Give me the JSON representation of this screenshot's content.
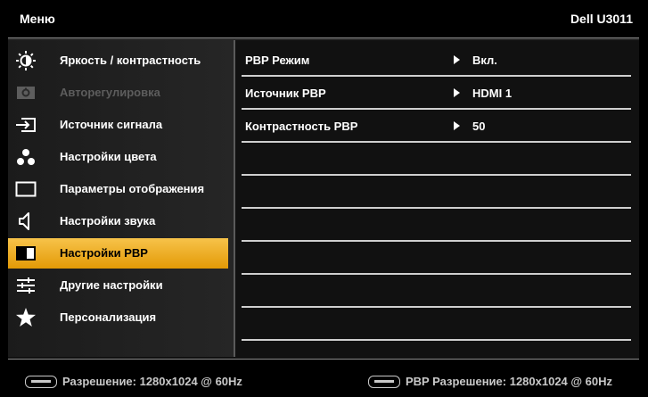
{
  "header": {
    "menu_title": "Меню",
    "model": "Dell U3011"
  },
  "sidebar": {
    "items": [
      {
        "label": "Яркость / контрастность",
        "icon": "brightness-icon",
        "state": "normal"
      },
      {
        "label": "Авторегулировка",
        "icon": "auto-adjust-icon",
        "state": "disabled"
      },
      {
        "label": "Источник сигнала",
        "icon": "input-source-icon",
        "state": "normal"
      },
      {
        "label": "Настройки цвета",
        "icon": "color-dots-icon",
        "state": "normal"
      },
      {
        "label": "Параметры отображения",
        "icon": "display-rectangle-icon",
        "state": "normal"
      },
      {
        "label": "Настройки звука",
        "icon": "speaker-icon",
        "state": "normal"
      },
      {
        "label": "Настройки PBP",
        "icon": "pbp-icon",
        "state": "active"
      },
      {
        "label": "Другие настройки",
        "icon": "sliders-icon",
        "state": "normal"
      },
      {
        "label": "Персонализация",
        "icon": "star-icon",
        "state": "normal"
      }
    ]
  },
  "settings": {
    "rows": [
      {
        "name": "PBP Режим",
        "value": "Вкл."
      },
      {
        "name": "Источник PBP",
        "value": "HDMI 1"
      },
      {
        "name": "Контрастность PBP",
        "value": "50"
      }
    ]
  },
  "status": {
    "main_resolution": "Разрешение: 1280x1024 @ 60Hz",
    "pbp_resolution": "PBP Разрешение: 1280x1024 @ 60Hz"
  },
  "colors": {
    "accent": "#f0b02a",
    "background": "#000000",
    "disabled_text": "#5d5d5d"
  }
}
